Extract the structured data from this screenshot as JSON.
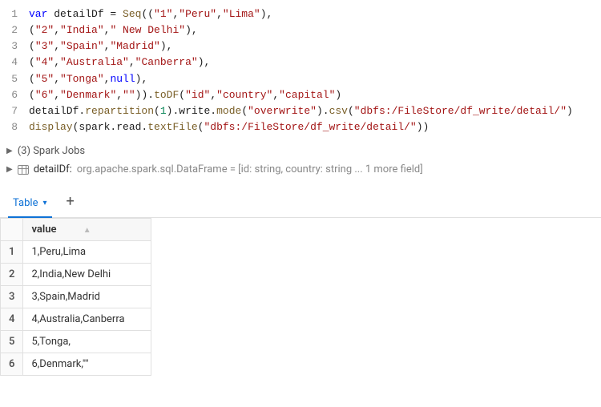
{
  "code": {
    "lines": [
      {
        "n": "1",
        "tokens": [
          {
            "c": "kw",
            "t": "var"
          },
          {
            "c": "plain",
            "t": " detailDf = "
          },
          {
            "c": "fn",
            "t": "Seq"
          },
          {
            "c": "plain",
            "t": "(("
          },
          {
            "c": "str",
            "t": "\"1\""
          },
          {
            "c": "plain",
            "t": ","
          },
          {
            "c": "str",
            "t": "\"Peru\""
          },
          {
            "c": "plain",
            "t": ","
          },
          {
            "c": "str",
            "t": "\"Lima\""
          },
          {
            "c": "plain",
            "t": "),"
          }
        ]
      },
      {
        "n": "2",
        "tokens": [
          {
            "c": "plain",
            "t": "("
          },
          {
            "c": "str",
            "t": "\"2\""
          },
          {
            "c": "plain",
            "t": ","
          },
          {
            "c": "str",
            "t": "\"India\""
          },
          {
            "c": "plain",
            "t": ","
          },
          {
            "c": "str",
            "t": "\" New Delhi\""
          },
          {
            "c": "plain",
            "t": "),"
          }
        ]
      },
      {
        "n": "3",
        "tokens": [
          {
            "c": "plain",
            "t": "("
          },
          {
            "c": "str",
            "t": "\"3\""
          },
          {
            "c": "plain",
            "t": ","
          },
          {
            "c": "str",
            "t": "\"Spain\""
          },
          {
            "c": "plain",
            "t": ","
          },
          {
            "c": "str",
            "t": "\"Madrid\""
          },
          {
            "c": "plain",
            "t": "),"
          }
        ]
      },
      {
        "n": "4",
        "tokens": [
          {
            "c": "plain",
            "t": "("
          },
          {
            "c": "str",
            "t": "\"4\""
          },
          {
            "c": "plain",
            "t": ","
          },
          {
            "c": "str",
            "t": "\"Australia\""
          },
          {
            "c": "plain",
            "t": ","
          },
          {
            "c": "str",
            "t": "\"Canberra\""
          },
          {
            "c": "plain",
            "t": "),"
          }
        ]
      },
      {
        "n": "5",
        "tokens": [
          {
            "c": "plain",
            "t": "("
          },
          {
            "c": "str",
            "t": "\"5\""
          },
          {
            "c": "plain",
            "t": ","
          },
          {
            "c": "str",
            "t": "\"Tonga\""
          },
          {
            "c": "plain",
            "t": ","
          },
          {
            "c": "null",
            "t": "null"
          },
          {
            "c": "plain",
            "t": "),"
          }
        ]
      },
      {
        "n": "6",
        "tokens": [
          {
            "c": "plain",
            "t": "("
          },
          {
            "c": "str",
            "t": "\"6\""
          },
          {
            "c": "plain",
            "t": ","
          },
          {
            "c": "str",
            "t": "\"Denmark\""
          },
          {
            "c": "plain",
            "t": ","
          },
          {
            "c": "str",
            "t": "\"\""
          },
          {
            "c": "plain",
            "t": "))."
          },
          {
            "c": "fn",
            "t": "toDF"
          },
          {
            "c": "plain",
            "t": "("
          },
          {
            "c": "str",
            "t": "\"id\""
          },
          {
            "c": "plain",
            "t": ","
          },
          {
            "c": "str",
            "t": "\"country\""
          },
          {
            "c": "plain",
            "t": ","
          },
          {
            "c": "str",
            "t": "\"capital\""
          },
          {
            "c": "plain",
            "t": ")"
          }
        ]
      },
      {
        "n": "7",
        "tokens": [
          {
            "c": "plain",
            "t": "detailDf."
          },
          {
            "c": "fn",
            "t": "repartition"
          },
          {
            "c": "plain",
            "t": "("
          },
          {
            "c": "num",
            "t": "1"
          },
          {
            "c": "plain",
            "t": ").write."
          },
          {
            "c": "fn",
            "t": "mode"
          },
          {
            "c": "plain",
            "t": "("
          },
          {
            "c": "str",
            "t": "\"overwrite\""
          },
          {
            "c": "plain",
            "t": ")."
          },
          {
            "c": "fn",
            "t": "csv"
          },
          {
            "c": "plain",
            "t": "("
          },
          {
            "c": "str",
            "t": "\"dbfs:/FileStore/df_write/detail/\""
          },
          {
            "c": "plain",
            "t": ")"
          }
        ]
      },
      {
        "n": "8",
        "tokens": [
          {
            "c": "fn",
            "t": "display"
          },
          {
            "c": "plain",
            "t": "(spark.read."
          },
          {
            "c": "fn",
            "t": "textFile"
          },
          {
            "c": "plain",
            "t": "("
          },
          {
            "c": "str",
            "t": "\"dbfs:/FileStore/df_write/detail/\""
          },
          {
            "c": "plain",
            "t": "))"
          }
        ]
      }
    ]
  },
  "jobs": {
    "label": "(3) Spark Jobs"
  },
  "dfinfo": {
    "var": "detailDf:",
    "sig": "org.apache.spark.sql.DataFrame = [id: string, country: string ... 1 more field]"
  },
  "tabs": {
    "active": "Table",
    "add": "+"
  },
  "table": {
    "header": "value",
    "rows": [
      {
        "i": "1",
        "v": "1,Peru,Lima"
      },
      {
        "i": "2",
        "v": "2,India,New Delhi"
      },
      {
        "i": "3",
        "v": "3,Spain,Madrid"
      },
      {
        "i": "4",
        "v": "4,Australia,Canberra"
      },
      {
        "i": "5",
        "v": "5,Tonga,"
      },
      {
        "i": "6",
        "v": "6,Denmark,\"\""
      }
    ]
  }
}
